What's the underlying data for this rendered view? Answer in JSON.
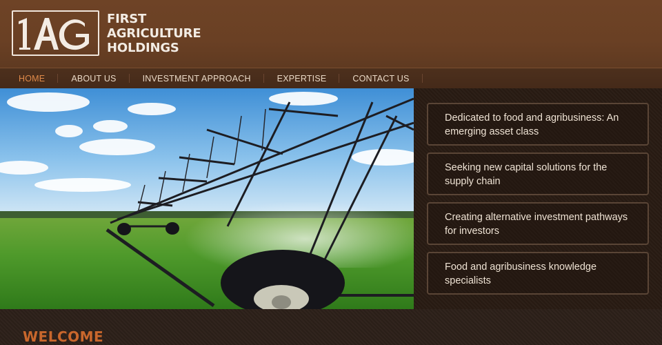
{
  "brand": {
    "logo_text": "1AG",
    "name_lines": [
      "FIRST",
      "AGRICULTURE",
      "HOLDINGS"
    ]
  },
  "nav": {
    "items": [
      {
        "label": "HOME",
        "active": true
      },
      {
        "label": "ABOUT US",
        "active": false
      },
      {
        "label": "INVESTMENT APPROACH",
        "active": false
      },
      {
        "label": "EXPERTISE",
        "active": false
      },
      {
        "label": "CONTACT US",
        "active": false
      }
    ]
  },
  "hero": {
    "image": "center-pivot-irrigation-field"
  },
  "features": [
    {
      "text": "Dedicated to food and agribusiness: An emerging asset class"
    },
    {
      "text": "Seeking new capital solutions for the supply chain"
    },
    {
      "text": "Creating alternative investment pathways for investors"
    },
    {
      "text": "Food and agribusiness knowledge specialists"
    }
  ],
  "welcome": {
    "heading": "WELCOME"
  },
  "colors": {
    "header_bg": "#6a4024",
    "nav_bg": "#4a2e1c",
    "nav_active": "#e08a4a",
    "panel_bg": "#2a1c14",
    "welcome": "#c9672c"
  }
}
